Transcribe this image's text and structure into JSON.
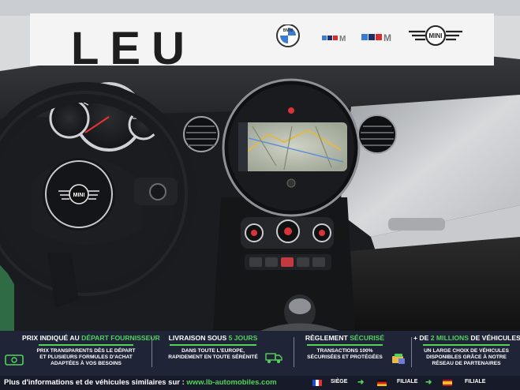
{
  "sign": {
    "text": "LEU",
    "brands": [
      "BMW",
      "M",
      "M",
      "MINI"
    ]
  },
  "banner": {
    "col1": {
      "title_a": "PRIX INDIQUÉ AU ",
      "title_b": "DÉPART FOURNISSEUR",
      "text": "PRIX TRANSPARENTS DÈS LE DÉPART\nET PLUSIEURS FORMULES D'ACHAT\nADAPTÉES À VOS BESOINS",
      "icon": "money-icon"
    },
    "col2": {
      "title_a": "LIVRAISON SOUS ",
      "title_b": "5 JOURS",
      "text": "DANS TOUTE L'EUROPE,\nRAPIDEMENT EN TOUTE SÉRÉNITÉ",
      "icon": "truck-icon"
    },
    "col3": {
      "title_a": "RÈGLEMENT ",
      "title_b": "SÉCURISÉ",
      "text": "TRANSACTIONS 100%\nSÉCURISÉES ET PROTÉGÉES",
      "icon": "secure-payment-icon"
    },
    "col4": {
      "title_a": "+ DE ",
      "title_b": "2 MILLIONS",
      "title_c": " DE VÉHICULES",
      "text": "UN LARGE CHOIX DE VÉHICULES\nDISPONIBLES GRÂCE À NOTRE\nRÉSEAU DE PARTENAIRES"
    }
  },
  "footer": {
    "info": "Plus d'informations et de véhicules similaires sur : ",
    "link": "www.lb-automobiles.com",
    "locations": [
      {
        "flag": "france-flag",
        "label": "SIÈGE"
      },
      {
        "flag": "germany-flag",
        "label": "FILIALE"
      },
      {
        "flag": "spain-flag",
        "label": "FILIALE"
      }
    ]
  },
  "colors": {
    "accent": "#53d35a",
    "banner": "#1f2437"
  }
}
